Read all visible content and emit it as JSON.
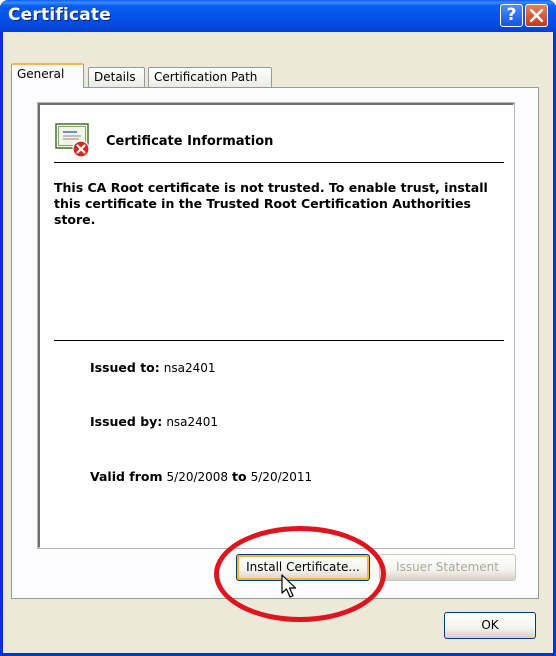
{
  "window": {
    "title": "Certificate"
  },
  "titlebar": {
    "help_label": "?"
  },
  "tabs": [
    {
      "label": "General",
      "active": true
    },
    {
      "label": "Details",
      "active": false
    },
    {
      "label": "Certification Path",
      "active": false
    }
  ],
  "general": {
    "heading": "Certificate Information",
    "message": "This CA Root certificate is not trusted. To enable trust, install this certificate in the Trusted Root Certification Authorities store.",
    "issued_to_label": "Issued to:",
    "issued_to_value": "nsa2401",
    "issued_by_label": "Issued by:",
    "issued_by_value": "nsa2401",
    "valid_from_label": "Valid from",
    "valid_from_value": "5/20/2008",
    "valid_to_label": "to",
    "valid_to_value": "5/20/2011"
  },
  "buttons": {
    "install": "Install Certificate...",
    "issuer": "Issuer Statement",
    "ok": "OK"
  },
  "colors": {
    "titlebar": "#0451e6",
    "highlight_ellipse": "#e0141e",
    "active_tab_accent": "#f7b64a"
  },
  "icons": {
    "certificate": "certificate-error-icon",
    "cursor": "mouse-pointer-icon"
  }
}
